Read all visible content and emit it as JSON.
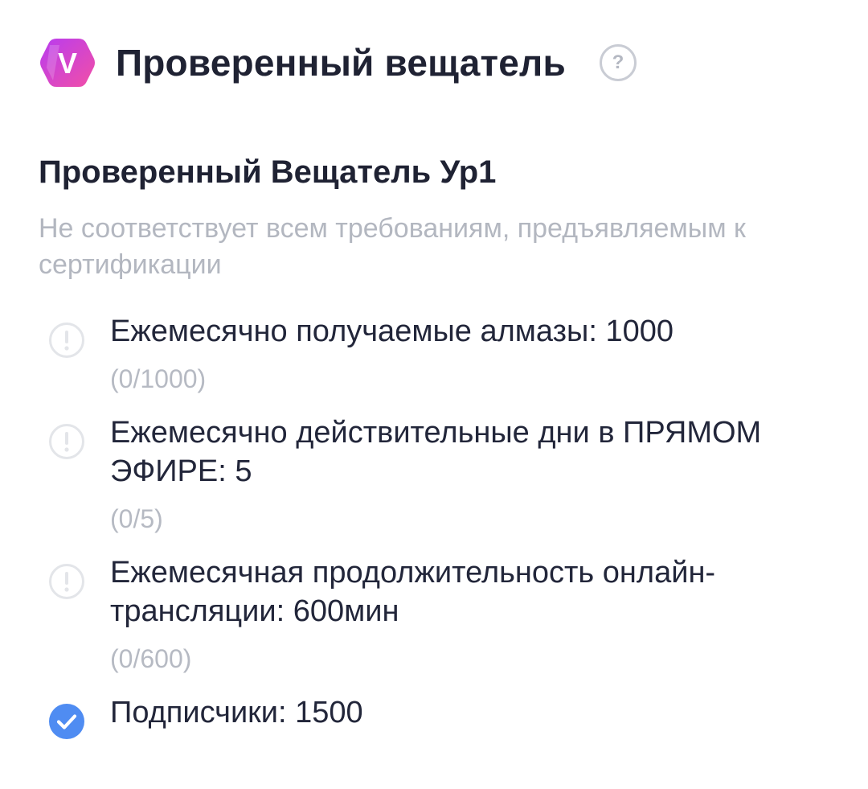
{
  "header": {
    "badge_letter": "V",
    "title": "Проверенный вещатель",
    "help_glyph": "?"
  },
  "level": {
    "title": "Проверенный Вещатель Ур1",
    "subtitle": "Не соответствует всем требованиям, предъявляемым к сертификации"
  },
  "requirements": [
    {
      "label": "Ежемесячно получаемые алмазы: 1000",
      "progress": "(0/1000)",
      "status": "not-met",
      "icon": "exclamation-circle-icon"
    },
    {
      "label": "Ежемесячно действительные дни в ПРЯМОМ ЭФИРЕ: 5",
      "progress": "(0/5)",
      "status": "not-met",
      "icon": "exclamation-circle-icon"
    },
    {
      "label": "Ежемесячная продолжительность онлайн-трансляции: 600мин",
      "progress": "(0/600)",
      "status": "not-met",
      "icon": "exclamation-circle-icon"
    },
    {
      "label": "Подписчики: 1500",
      "status": "met",
      "icon": "check-circle-icon"
    }
  ],
  "colors": {
    "badge_gradient_start": "#b83cf0",
    "badge_gradient_end": "#f24fa6",
    "title_text": "#1f2233",
    "muted_text": "#b3b7c0",
    "check_blue": "#4f8cf2",
    "warning_gray": "#e3e5e9"
  }
}
